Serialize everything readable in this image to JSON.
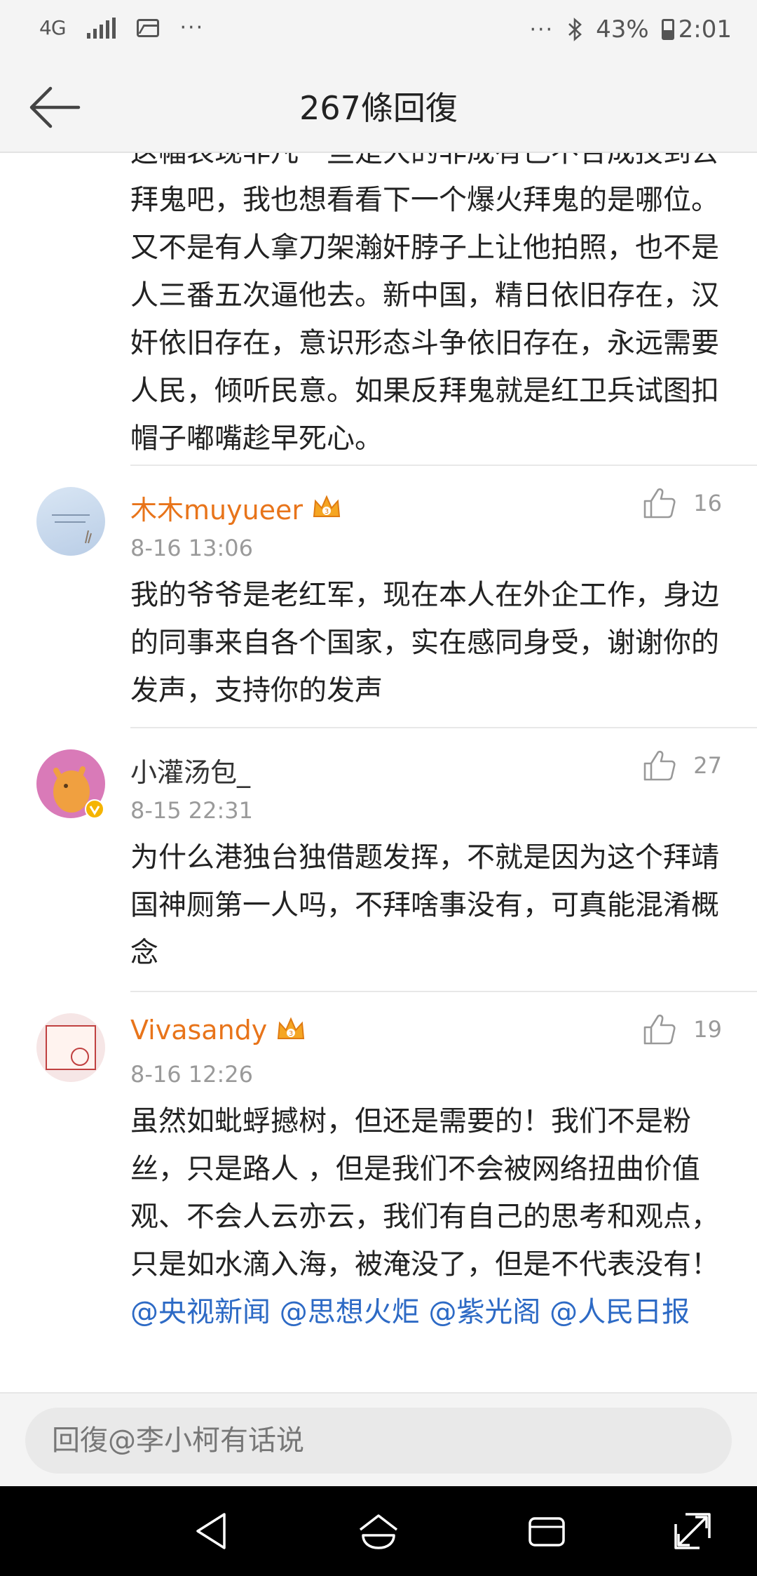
{
  "status_bar": {
    "network": "4G",
    "more": "···",
    "right_more": "···",
    "battery": "43%",
    "time": "2:01"
  },
  "header": {
    "title": "267條回復"
  },
  "continued_comment": {
    "text": "这幅表现非凡一些是大的非成有已不合成技到去拜鬼吧，我也想看看下一个爆火拜鬼的是哪位。又不是有人拿刀架瀚奸脖子上让他拍照，也不是人三番五次逼他去。新中国，精日依旧存在，汉奸依旧存在，意识形态斗争依旧存在，永远需要人民，倾听民意。如果反拜鬼就是红卫兵试图扣帽子嘟嘴趁早死心。"
  },
  "comments": [
    {
      "username": "木木muyueer",
      "vip": true,
      "time": "8-16 13:06",
      "likes": "16",
      "text": "我的爷爷是老红军，现在本人在外企工作，身边的同事来自各个国家，实在感同身受，谢谢你的发声，支持你的发声"
    },
    {
      "username": "小灌汤包_",
      "vip": false,
      "verified": true,
      "time": "8-15 22:31",
      "likes": "27",
      "text": "为什么港独台独借题发挥，不就是因为这个拜靖国神厕第一人吗，不拜啥事没有，可真能混淆概念"
    },
    {
      "username": "Vivasandy",
      "vip": true,
      "time": "8-16 12:26",
      "likes": "19",
      "text": "虽然如蚍蜉撼树，但还是需要的！我们不是粉丝，只是路人 ，但是我们不会被网络扭曲价值观、不会人云亦云，我们有自己的思考和观点，只是如水滴入海，被淹没了，但是不代表没有！",
      "mentions": [
        "@央视新闻",
        "@思想火炬",
        "@紫光阁",
        "@人民日报"
      ]
    }
  ],
  "reply_bar": {
    "placeholder": "回復@李小柯有话说"
  },
  "colors": {
    "vip_name": "#e8741a",
    "mention": "#2d6ac5"
  }
}
